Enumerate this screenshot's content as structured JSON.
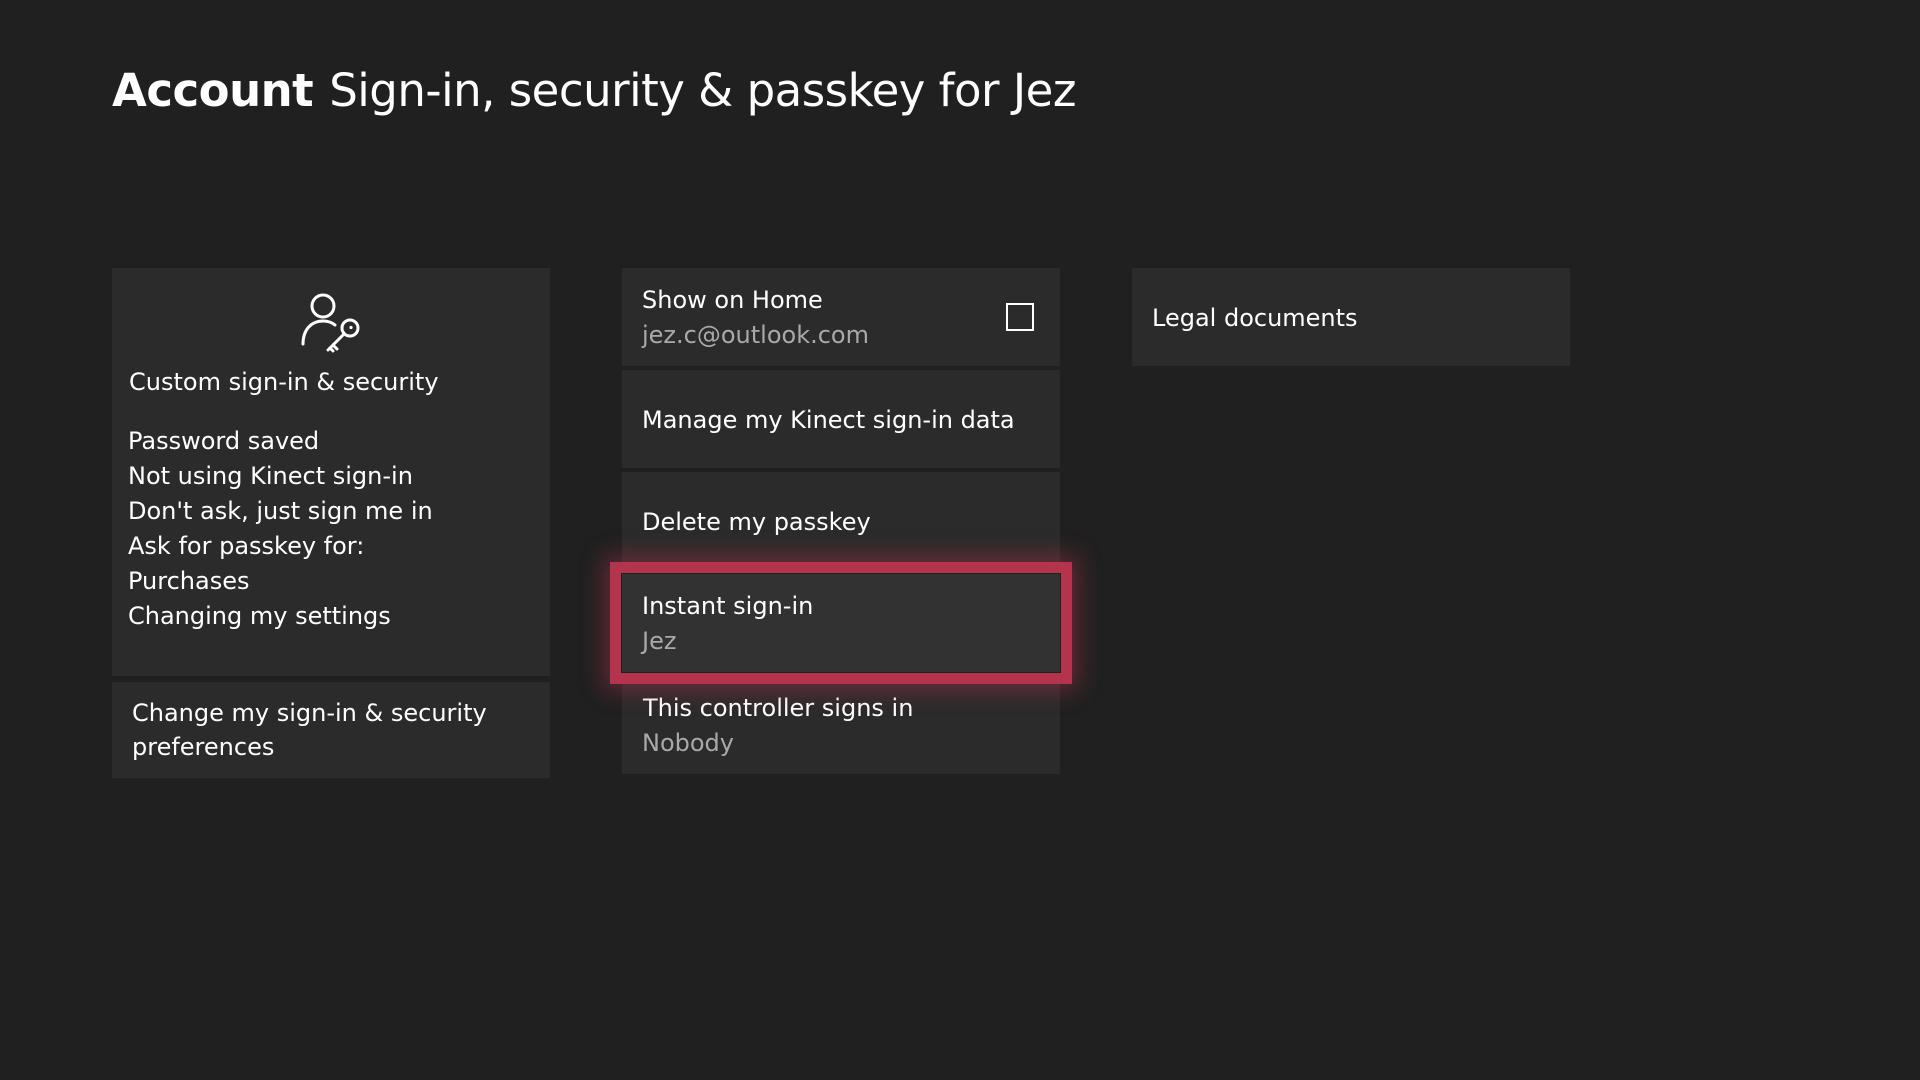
{
  "header": {
    "section": "Account",
    "title": "Sign-in, security & passkey for Jez"
  },
  "custom_security": {
    "icon": "user-key-icon",
    "title": "Custom sign-in & security",
    "details": [
      "Password saved",
      "Not using Kinect sign-in",
      "Don't ask, just sign me in",
      "Ask for passkey for:",
      "Purchases",
      "Changing my settings"
    ]
  },
  "change_prefs": {
    "label": "Change my sign-in & security preferences"
  },
  "show_on_home": {
    "label": "Show on Home",
    "value": "jez.c@outlook.com",
    "checked": false
  },
  "kinect": {
    "label": "Manage my Kinect sign-in data"
  },
  "passkey": {
    "label": "Delete my passkey"
  },
  "instant_signin": {
    "label": "Instant sign-in",
    "value": "Jez",
    "focused": true
  },
  "controller": {
    "label": "This controller signs in",
    "value": "Nobody"
  },
  "legal": {
    "label": "Legal documents"
  },
  "colors": {
    "background": "#202020",
    "tile": "#2b2b2b",
    "focus": "#b5344d",
    "secondary_text": "#a9a9a9"
  }
}
